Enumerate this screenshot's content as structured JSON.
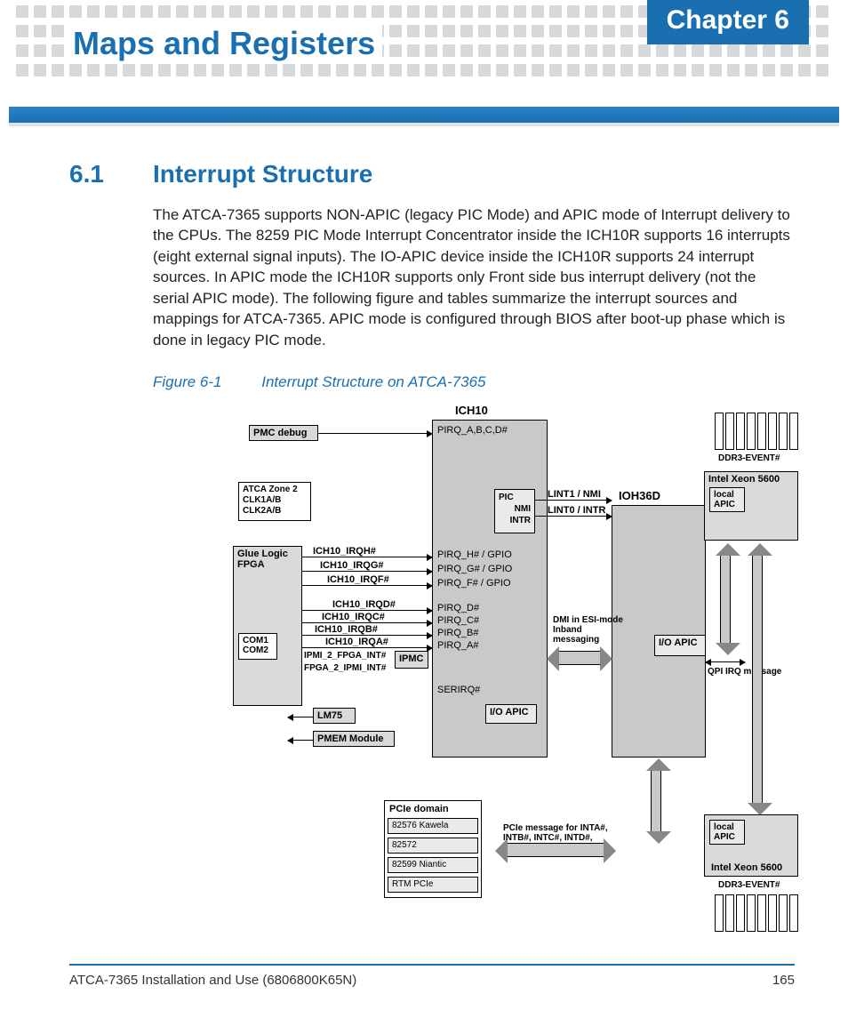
{
  "header": {
    "chapter_label": "Chapter 6",
    "doc_title": "Maps and Registers"
  },
  "section": {
    "number": "6.1",
    "title": "Interrupt Structure",
    "body": "The ATCA-7365 supports NON-APIC (legacy PIC Mode) and APIC mode of Interrupt delivery to the CPUs. The 8259 PIC Mode Interrupt Concentrator inside the ICH10R supports 16 interrupts (eight external signal inputs). The IO-APIC device inside the ICH10R supports 24 interrupt sources. In APIC mode the ICH10R supports only Front side bus interrupt delivery (not the serial APIC mode). The following figure and tables summarize the interrupt sources and mappings for ATCA-7365. APIC mode is configured through BIOS after boot-up phase which is done in legacy PIC mode."
  },
  "figure": {
    "number": "Figure 6-1",
    "title": "Interrupt Structure on ATCA-7365"
  },
  "diagram": {
    "ich10_title": "ICH10",
    "ioh36d_title": "IOH36D",
    "pmc_debug": "PMC debug",
    "atca_zone": "ATCA Zone 2 CLK1A/B CLK2A/B",
    "glue_fpga": "Glue Logic FPGA",
    "com": "COM1 COM2",
    "ipmc": "IPMC",
    "lm75": "LM75",
    "pmem": "PMEM Module",
    "pic": "PIC",
    "nmi": "NMI",
    "intr": "INTR",
    "io_apic": "I/O APIC",
    "io_apic2": "I/O APIC",
    "local_apic": "local APIC",
    "xeon": "Intel Xeon 5600",
    "pcie_domain": "PCIe domain",
    "pcie_items": [
      "82576 Kawela",
      "82572",
      "82599 Niantic",
      "RTM PCIe"
    ],
    "signals": {
      "pirq_abcd": "PIRQ_A,B,C,D#",
      "irqh": "ICH10_IRQH#",
      "irqg": "ICH10_IRQG#",
      "irqf": "ICH10_IRQF#",
      "irqd": "ICH10_IRQD#",
      "irqc": "ICH10_IRQC#",
      "irqb": "ICH10_IRQB#",
      "irqa": "ICH10_IRQA#",
      "ipmi2fpga": "IPMI_2_FPGA_INT#",
      "fpga2ipmi": "FPGA_2_IPMI_INT#",
      "pirq_h": "PIRQ_H# / GPIO",
      "pirq_g": "PIRQ_G# / GPIO",
      "pirq_f": "PIRQ_F# / GPIO",
      "pirq_d": "PIRQ_D#",
      "pirq_c": "PIRQ_C#",
      "pirq_b": "PIRQ_B#",
      "pirq_a": "PIRQ_A#",
      "serirq": "SERIRQ#",
      "lint1": "LINT1 / NMI",
      "lint0": "LINT0 / INTR",
      "dmi": "DMI in ESI-mode Inband messaging",
      "qpi": "QPI IRQ message",
      "ddr3": "DDR3-EVENT#",
      "pcie_msg": "PCIe message for INTA#, INTB#, INTC#, INTD#,"
    }
  },
  "footer": {
    "left": "ATCA-7365 Installation and Use (6806800K65N)",
    "right": "165"
  }
}
